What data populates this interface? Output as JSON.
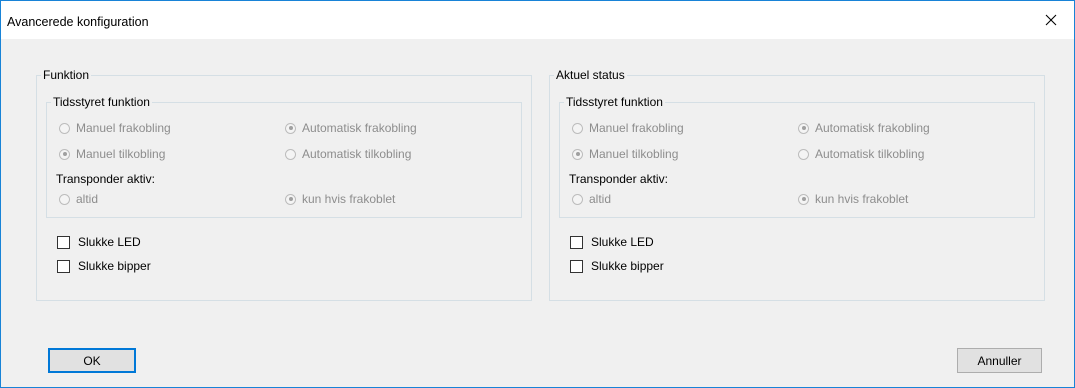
{
  "window": {
    "title": "Avancerede konfiguration"
  },
  "left_panel": {
    "title": "Funktion",
    "timed_group": {
      "title": "Tidsstyret funktion",
      "options": [
        {
          "label": "Manuel frakobling",
          "checked": false,
          "enabled": false
        },
        {
          "label": "Automatisk frakobling",
          "checked": true,
          "enabled": false
        },
        {
          "label": "Manuel tilkobling",
          "checked": true,
          "enabled": false
        },
        {
          "label": "Automatisk tilkobling",
          "checked": false,
          "enabled": false
        }
      ],
      "transponder_label": "Transponder aktiv:",
      "transponder_options": [
        {
          "label": "altid",
          "checked": false,
          "enabled": false
        },
        {
          "label": "kun hvis frakoblet",
          "checked": true,
          "enabled": false
        }
      ]
    },
    "checkboxes": [
      {
        "label": "Slukke LED",
        "checked": false
      },
      {
        "label": "Slukke bipper",
        "checked": false
      }
    ]
  },
  "right_panel": {
    "title": "Aktuel status",
    "timed_group": {
      "title": "Tidsstyret funktion",
      "options": [
        {
          "label": "Manuel frakobling",
          "checked": false,
          "enabled": false
        },
        {
          "label": "Automatisk frakobling",
          "checked": true,
          "enabled": false
        },
        {
          "label": "Manuel tilkobling",
          "checked": true,
          "enabled": false
        },
        {
          "label": "Automatisk tilkobling",
          "checked": false,
          "enabled": false
        }
      ],
      "transponder_label": "Transponder aktiv:",
      "transponder_options": [
        {
          "label": "altid",
          "checked": false,
          "enabled": false
        },
        {
          "label": "kun hvis frakoblet",
          "checked": true,
          "enabled": false
        }
      ]
    },
    "checkboxes": [
      {
        "label": "Slukke LED",
        "checked": false
      },
      {
        "label": "Slukke bipper",
        "checked": false
      }
    ]
  },
  "buttons": {
    "ok_label": "OK",
    "cancel_label": "Annuller"
  },
  "colors": {
    "accent": "#0078d7",
    "window_border": "#1883d7",
    "disabled_text": "#8d8d8d",
    "group_border": "#d5dfe5"
  }
}
